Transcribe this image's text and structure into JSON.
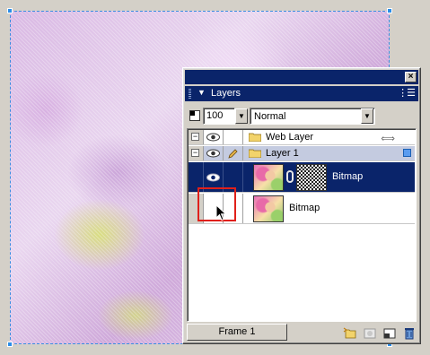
{
  "panel": {
    "title": "Layers",
    "close_label": "×",
    "opacity_value": "100",
    "blend_mode": "Normal",
    "frame_label": "Frame 1"
  },
  "layers": [
    {
      "type": "folder",
      "label": "Web Layer",
      "expander": "⊟",
      "selected": false
    },
    {
      "type": "folder",
      "label": "Layer 1",
      "expander": "⊟",
      "selected": true
    },
    {
      "type": "bitmap",
      "label": "Bitmap",
      "selected": true,
      "has_mask": true
    },
    {
      "type": "bitmap",
      "label": "Bitmap",
      "selected": false,
      "has_mask": false
    }
  ],
  "colors": {
    "selection": "#0a246a",
    "annotation": "#e0201a",
    "canvas_border": "#3a8fe0"
  },
  "icons": [
    "eye-icon",
    "folder-icon",
    "pencil-icon",
    "move-icon",
    "new-sublayer-icon",
    "add-mask-icon",
    "new-layer-icon",
    "trash-icon"
  ]
}
